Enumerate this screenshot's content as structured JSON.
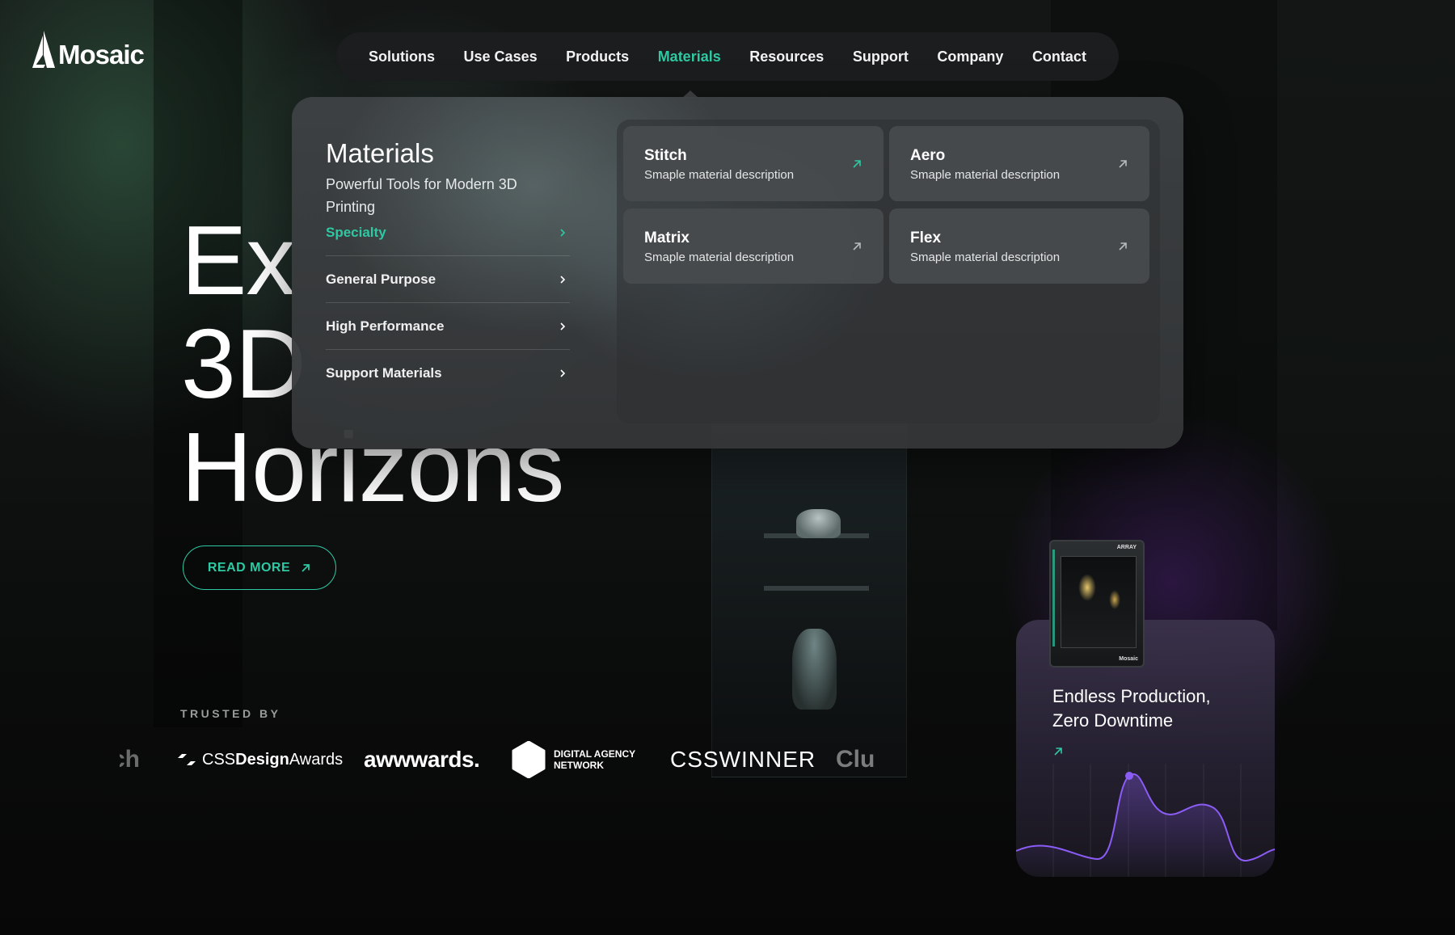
{
  "brand": {
    "name": "Mosaic"
  },
  "nav": {
    "items": [
      {
        "label": "Solutions",
        "active": false
      },
      {
        "label": "Use Cases",
        "active": false
      },
      {
        "label": "Products",
        "active": false
      },
      {
        "label": "Materials",
        "active": true
      },
      {
        "label": "Resources",
        "active": false
      },
      {
        "label": "Support",
        "active": false
      },
      {
        "label": "Company",
        "active": false
      },
      {
        "label": "Contact",
        "active": false
      }
    ]
  },
  "hero": {
    "line1": "Ex",
    "line2": "3D",
    "line3": "Horizons",
    "cta": "READ MORE"
  },
  "mega_menu": {
    "title": "Materials",
    "subtitle": "Powerful Tools for Modern 3D Printing",
    "categories": [
      {
        "label": "Specialty",
        "active": true
      },
      {
        "label": "General Purpose",
        "active": false
      },
      {
        "label": "High Performance",
        "active": false
      },
      {
        "label": "Support Materials",
        "active": false
      }
    ],
    "cards": [
      {
        "title": "Stitch",
        "desc": "Smaple material description"
      },
      {
        "title": "Aero",
        "desc": "Smaple material description"
      },
      {
        "title": "Matrix",
        "desc": "Smaple material description"
      },
      {
        "title": "Flex",
        "desc": "Smaple material description"
      }
    ]
  },
  "trusted": {
    "label": "TRUSTED BY",
    "logos": {
      "partial_left": "ch",
      "css_design_prefix": "CSS",
      "css_design_bold": "Design",
      "css_design_suffix": "Awards",
      "awwwards": "awwwards.",
      "dan_line1": "DIGITAL AGENCY",
      "dan_line2": "NETWORK",
      "csswinner": "CSSWINNER",
      "partial_right": "Clu"
    }
  },
  "promo": {
    "title": "Endless Production, Zero Downtime",
    "machine_label": "ARRAY",
    "machine_brand": "Mosaic"
  },
  "colors": {
    "accent": "#2ec9a3",
    "purple": "#8b5cf6",
    "nav_bg": "#1b1d1e"
  },
  "icons": {
    "arrow": "arrow-up-right-icon",
    "chevron": "chevron-right-icon"
  }
}
